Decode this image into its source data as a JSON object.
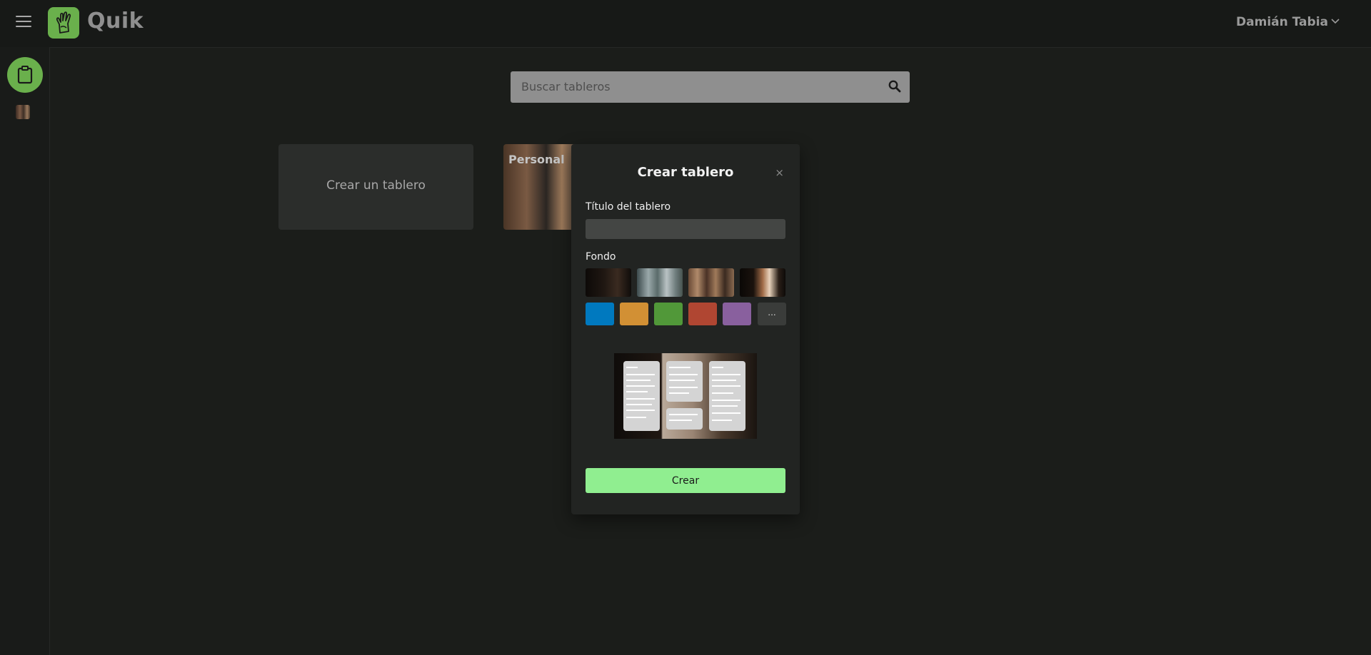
{
  "app": {
    "name": "Quik",
    "logo_icon": "hand-icon"
  },
  "header": {
    "user_name": "Damián Tabia"
  },
  "sidebar": {
    "items": [
      {
        "icon": "clipboard-icon"
      },
      {
        "icon": "board-thumbnail"
      }
    ]
  },
  "search": {
    "placeholder": "Buscar tableros",
    "icon": "search-icon"
  },
  "boards": {
    "create_label": "Crear un tablero",
    "items": [
      {
        "title": "Personal"
      }
    ]
  },
  "modal": {
    "title": "Crear tablero",
    "close_symbol": "×",
    "title_field_label": "Título del tablero",
    "title_field_value": "",
    "background_label": "Fondo",
    "background_photos": [
      "photo-dark-interior",
      "photo-canal",
      "photo-street",
      "photo-doorway"
    ],
    "background_colors": [
      "#0079bf",
      "#d29034",
      "#519839",
      "#b04632",
      "#89609e"
    ],
    "more_label": "...",
    "submit_label": "Crear"
  }
}
